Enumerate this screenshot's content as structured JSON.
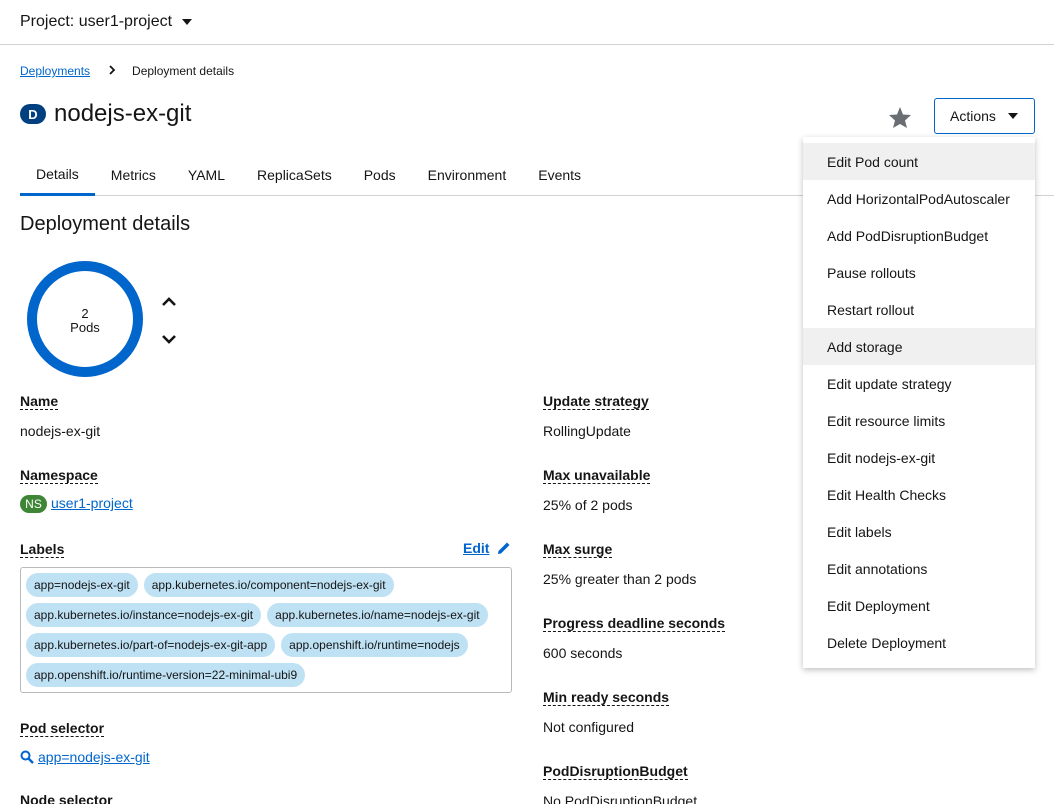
{
  "topbar": {
    "project_label": "Project: user1-project"
  },
  "breadcrumb": {
    "parent": "Deployments",
    "current": "Deployment details"
  },
  "header": {
    "badge": "D",
    "title": "nodejs-ex-git",
    "actions_label": "Actions"
  },
  "tabs": [
    "Details",
    "Metrics",
    "YAML",
    "ReplicaSets",
    "Pods",
    "Environment",
    "Events"
  ],
  "section_title": "Deployment details",
  "pods": {
    "count": "2",
    "unit": "Pods"
  },
  "left_fields": {
    "name": {
      "label": "Name",
      "value": "nodejs-ex-git"
    },
    "namespace": {
      "label": "Namespace",
      "badge": "NS",
      "value": "user1-project"
    },
    "labels": {
      "label": "Labels",
      "edit": "Edit"
    },
    "pod_selector": {
      "label": "Pod selector",
      "value": "app=nodejs-ex-git"
    },
    "node_selector": {
      "label": "Node selector"
    }
  },
  "labels": [
    "app=nodejs-ex-git",
    "app.kubernetes.io/component=nodejs-ex-git",
    "app.kubernetes.io/instance=nodejs-ex-git",
    "app.kubernetes.io/name=nodejs-ex-git",
    "app.kubernetes.io/part-of=nodejs-ex-git-app",
    "app.openshift.io/runtime=nodejs",
    "app.openshift.io/runtime-version=22-minimal-ubi9"
  ],
  "right_fields": {
    "update_strategy": {
      "label": "Update strategy",
      "value": "RollingUpdate"
    },
    "max_unavailable": {
      "label": "Max unavailable",
      "value": "25% of 2 pods"
    },
    "max_surge": {
      "label": "Max surge",
      "value": "25% greater than 2 pods"
    },
    "progress_deadline": {
      "label": "Progress deadline seconds",
      "value": "600 seconds"
    },
    "min_ready": {
      "label": "Min ready seconds",
      "value": "Not configured"
    },
    "pdb": {
      "label": "PodDisruptionBudget",
      "value": "No PodDisruptionBudget"
    }
  },
  "actions_menu": [
    "Edit Pod count",
    "Add HorizontalPodAutoscaler",
    "Add PodDisruptionBudget",
    "Pause rollouts",
    "Restart rollout",
    "Add storage",
    "Edit update strategy",
    "Edit resource limits",
    "Edit nodejs-ex-git",
    "Edit Health Checks",
    "Edit labels",
    "Edit annotations",
    "Edit Deployment",
    "Delete Deployment"
  ],
  "colors": {
    "accent": "#0066cc",
    "donut": "#0066cc",
    "label_chip": "#bee1f4",
    "ns_badge": "#3e8635",
    "resource_badge": "#004080"
  },
  "icons": {
    "star": "star-icon",
    "search": "search-icon",
    "pencil": "pencil-icon",
    "chevron_up": "chevron-up-icon",
    "chevron_down": "chevron-down-icon"
  }
}
